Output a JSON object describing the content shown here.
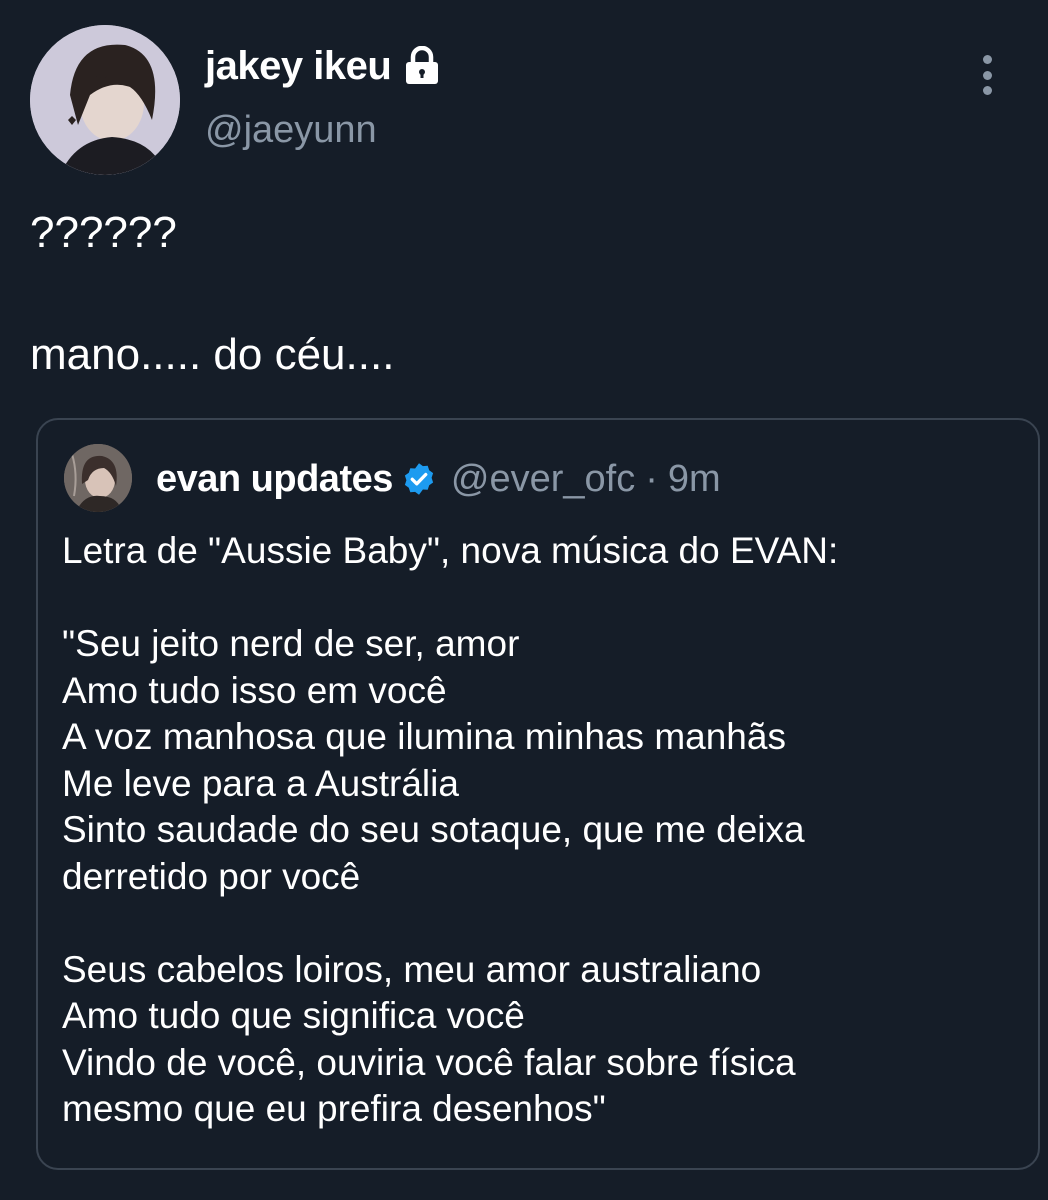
{
  "author": {
    "display_name": "jakey ikeu",
    "handle": "@jaeyunn",
    "protected_icon": "lock-icon",
    "avatar_icon": "avatar-photo"
  },
  "tweet": {
    "line1": "??????",
    "line2": "mano..... do céu...."
  },
  "more_icon": "more-vertical-icon",
  "quote": {
    "display_name": "evan updates",
    "verified_icon": "verified-badge-icon",
    "handle": "@ever_ofc",
    "separator": "·",
    "time": "9m",
    "lines": [
      "Letra de \"Aussie Baby\", nova música do EVAN:",
      "",
      "\"Seu jeito nerd de ser, amor",
      "Amo tudo isso em você",
      "A voz manhosa que ilumina minhas manhãs",
      "Me leve para a Austrália",
      "Sinto saudade do seu sotaque, que me deixa",
      "derretido por você",
      "",
      "Seus cabelos loiros, meu amor australiano",
      "Amo tudo que significa você",
      "Vindo de você, ouviria você falar sobre física",
      "mesmo que eu prefira desenhos\""
    ]
  },
  "colors": {
    "background": "#151d28",
    "text": "#ffffff",
    "secondary_text": "#8a97a6",
    "border": "#3a4451",
    "verified": "#1d9bf0"
  }
}
